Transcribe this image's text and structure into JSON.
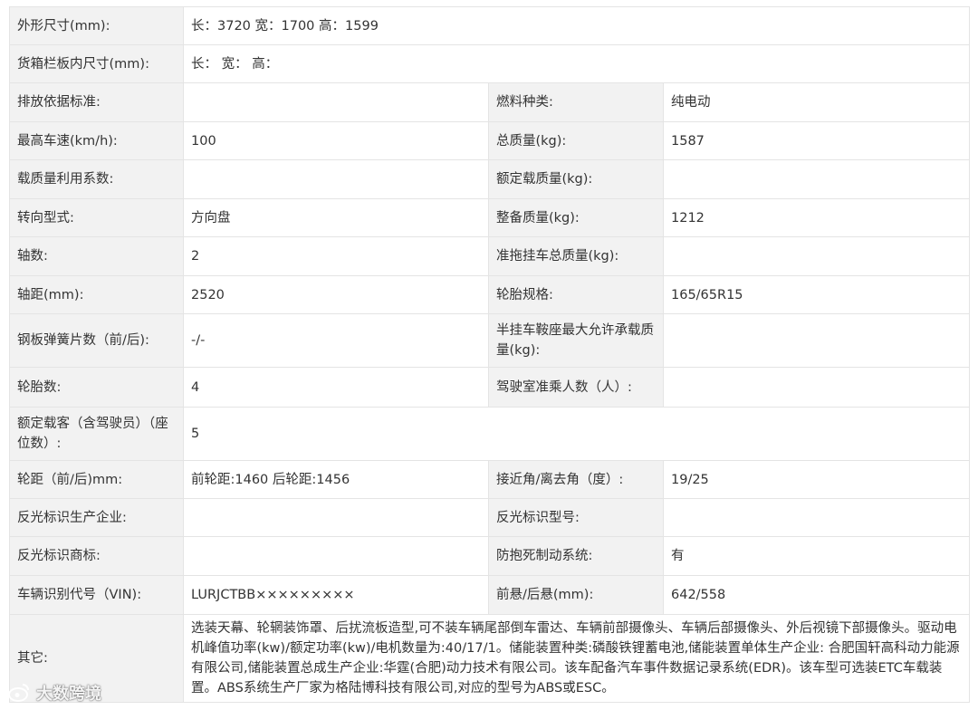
{
  "rows": [
    {
      "l1": "外形尺寸(mm):",
      "v1": "长：3720 宽：1700 高：1599"
    },
    {
      "l1": "货箱栏板内尺寸(mm):",
      "v1": "长： 宽： 高："
    },
    {
      "l1": "排放依据标准:",
      "v1": "",
      "l2": "燃料种类:",
      "v2": "纯电动"
    },
    {
      "l1": "最高车速(km/h):",
      "v1": "100",
      "l2": "总质量(kg):",
      "v2": "1587"
    },
    {
      "l1": "载质量利用系数:",
      "v1": "",
      "l2": "额定载质量(kg):",
      "v2": ""
    },
    {
      "l1": "转向型式:",
      "v1": "方向盘",
      "l2": "整备质量(kg):",
      "v2": "1212"
    },
    {
      "l1": "轴数:",
      "v1": "2",
      "l2": "准拖挂车总质量(kg):",
      "v2": ""
    },
    {
      "l1": "轴距(mm):",
      "v1": "2520",
      "l2": "轮胎规格:",
      "v2": "165/65R15"
    },
    {
      "l1": "钢板弹簧片数（前/后):",
      "v1": "-/-",
      "l2": "半挂车鞍座最大允许承载质量(kg):",
      "v2": ""
    },
    {
      "l1": "轮胎数:",
      "v1": "4",
      "l2": "驾驶室准乘人数（人）:",
      "v2": ""
    },
    {
      "l1": "额定载客（含驾驶员）（座位数）:",
      "v1": "5"
    },
    {
      "l1": "轮距（前/后)mm:",
      "v1": "前轮距:1460 后轮距:1456",
      "l2": "接近角/离去角（度）:",
      "v2": "19/25"
    },
    {
      "l1": "反光标识生产企业:",
      "v1": "",
      "l2": "反光标识型号:",
      "v2": ""
    },
    {
      "l1": "反光标识商标:",
      "v1": "",
      "l2": "防抱死制动系统:",
      "v2": "有"
    },
    {
      "l1": "车辆识别代号（VIN):",
      "v1": "LURJCTBB×××××××××",
      "l2": "前悬/后悬(mm):",
      "v2": "642/558"
    }
  ],
  "other": {
    "label": "其它:",
    "value": "选装天幕、轮辋装饰罩、后扰流板造型,可不装车辆尾部倒车雷达、车辆前部摄像头、车辆后部摄像头、外后视镜下部摄像头。驱动电机峰值功率(kw)/额定功率(kw)/电机数量为:40/17/1。储能装置种类:磷酸铁锂蓄电池,储能装置单体生产企业: 合肥国轩高科动力能源有限公司,储能装置总成生产企业:华霆(合肥)动力技术有限公司。该车配备汽车事件数据记录系统(EDR)。该车型可选装ETC车载装置。ABS系统生产厂家为格陆博科技有限公司,对应的型号为ABS或ESC。"
  },
  "watermark": {
    "text": "大数跨境",
    "icon": "weibo-logo-icon"
  }
}
